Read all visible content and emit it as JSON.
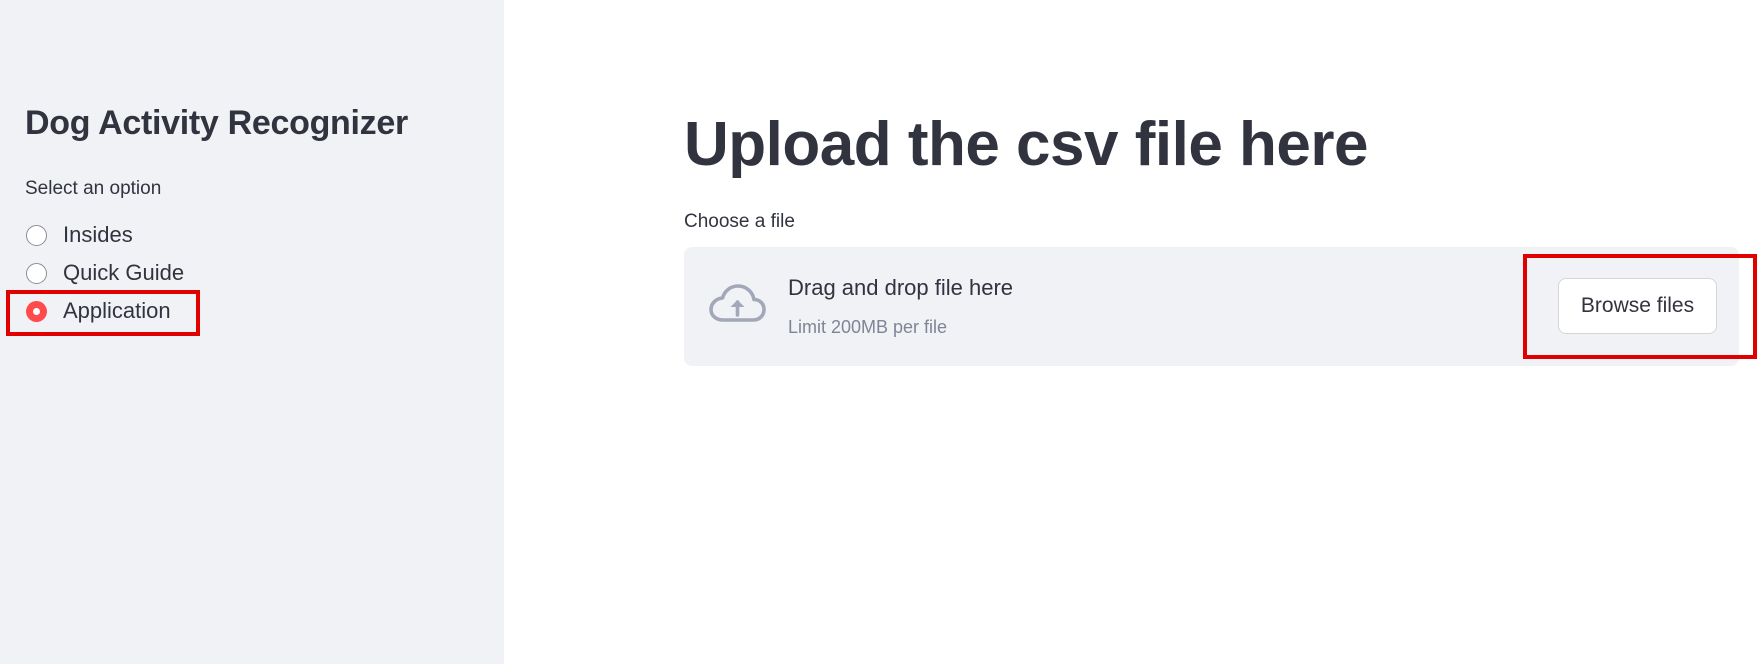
{
  "sidebar": {
    "title": "Dog Activity Recognizer",
    "radio_label": "Select an option",
    "options": [
      {
        "label": "Insides",
        "selected": false
      },
      {
        "label": "Quick Guide",
        "selected": false
      },
      {
        "label": "Application",
        "selected": true
      }
    ]
  },
  "main": {
    "title": "Upload the csv file here",
    "uploader": {
      "label": "Choose a file",
      "drag_text": "Drag and drop file here",
      "limit_text": "Limit 200MB per file",
      "browse_label": "Browse files",
      "icon": "cloud-upload-icon"
    }
  },
  "colors": {
    "accent": "#ff4b4b",
    "sidebar_bg": "#f0f2f6",
    "text": "#31333f",
    "muted_text": "#808495",
    "highlight": "#e00000"
  }
}
